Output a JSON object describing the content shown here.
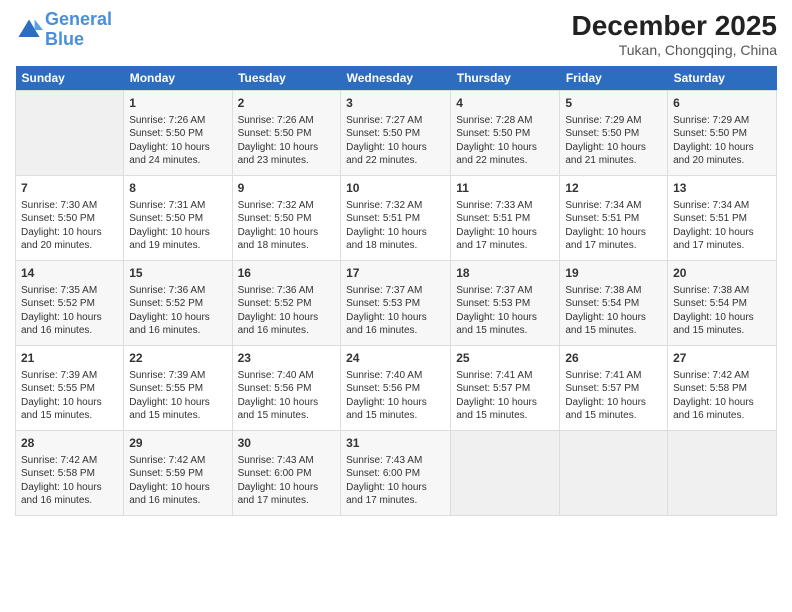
{
  "header": {
    "logo_line1": "General",
    "logo_line2": "Blue",
    "month": "December 2025",
    "location": "Tukan, Chongqing, China"
  },
  "weekdays": [
    "Sunday",
    "Monday",
    "Tuesday",
    "Wednesday",
    "Thursday",
    "Friday",
    "Saturday"
  ],
  "weeks": [
    [
      {
        "day": "",
        "info": ""
      },
      {
        "day": "1",
        "info": "Sunrise: 7:26 AM\nSunset: 5:50 PM\nDaylight: 10 hours\nand 24 minutes."
      },
      {
        "day": "2",
        "info": "Sunrise: 7:26 AM\nSunset: 5:50 PM\nDaylight: 10 hours\nand 23 minutes."
      },
      {
        "day": "3",
        "info": "Sunrise: 7:27 AM\nSunset: 5:50 PM\nDaylight: 10 hours\nand 22 minutes."
      },
      {
        "day": "4",
        "info": "Sunrise: 7:28 AM\nSunset: 5:50 PM\nDaylight: 10 hours\nand 22 minutes."
      },
      {
        "day": "5",
        "info": "Sunrise: 7:29 AM\nSunset: 5:50 PM\nDaylight: 10 hours\nand 21 minutes."
      },
      {
        "day": "6",
        "info": "Sunrise: 7:29 AM\nSunset: 5:50 PM\nDaylight: 10 hours\nand 20 minutes."
      }
    ],
    [
      {
        "day": "7",
        "info": "Sunrise: 7:30 AM\nSunset: 5:50 PM\nDaylight: 10 hours\nand 20 minutes."
      },
      {
        "day": "8",
        "info": "Sunrise: 7:31 AM\nSunset: 5:50 PM\nDaylight: 10 hours\nand 19 minutes."
      },
      {
        "day": "9",
        "info": "Sunrise: 7:32 AM\nSunset: 5:50 PM\nDaylight: 10 hours\nand 18 minutes."
      },
      {
        "day": "10",
        "info": "Sunrise: 7:32 AM\nSunset: 5:51 PM\nDaylight: 10 hours\nand 18 minutes."
      },
      {
        "day": "11",
        "info": "Sunrise: 7:33 AM\nSunset: 5:51 PM\nDaylight: 10 hours\nand 17 minutes."
      },
      {
        "day": "12",
        "info": "Sunrise: 7:34 AM\nSunset: 5:51 PM\nDaylight: 10 hours\nand 17 minutes."
      },
      {
        "day": "13",
        "info": "Sunrise: 7:34 AM\nSunset: 5:51 PM\nDaylight: 10 hours\nand 17 minutes."
      }
    ],
    [
      {
        "day": "14",
        "info": "Sunrise: 7:35 AM\nSunset: 5:52 PM\nDaylight: 10 hours\nand 16 minutes."
      },
      {
        "day": "15",
        "info": "Sunrise: 7:36 AM\nSunset: 5:52 PM\nDaylight: 10 hours\nand 16 minutes."
      },
      {
        "day": "16",
        "info": "Sunrise: 7:36 AM\nSunset: 5:52 PM\nDaylight: 10 hours\nand 16 minutes."
      },
      {
        "day": "17",
        "info": "Sunrise: 7:37 AM\nSunset: 5:53 PM\nDaylight: 10 hours\nand 16 minutes."
      },
      {
        "day": "18",
        "info": "Sunrise: 7:37 AM\nSunset: 5:53 PM\nDaylight: 10 hours\nand 15 minutes."
      },
      {
        "day": "19",
        "info": "Sunrise: 7:38 AM\nSunset: 5:54 PM\nDaylight: 10 hours\nand 15 minutes."
      },
      {
        "day": "20",
        "info": "Sunrise: 7:38 AM\nSunset: 5:54 PM\nDaylight: 10 hours\nand 15 minutes."
      }
    ],
    [
      {
        "day": "21",
        "info": "Sunrise: 7:39 AM\nSunset: 5:55 PM\nDaylight: 10 hours\nand 15 minutes."
      },
      {
        "day": "22",
        "info": "Sunrise: 7:39 AM\nSunset: 5:55 PM\nDaylight: 10 hours\nand 15 minutes."
      },
      {
        "day": "23",
        "info": "Sunrise: 7:40 AM\nSunset: 5:56 PM\nDaylight: 10 hours\nand 15 minutes."
      },
      {
        "day": "24",
        "info": "Sunrise: 7:40 AM\nSunset: 5:56 PM\nDaylight: 10 hours\nand 15 minutes."
      },
      {
        "day": "25",
        "info": "Sunrise: 7:41 AM\nSunset: 5:57 PM\nDaylight: 10 hours\nand 15 minutes."
      },
      {
        "day": "26",
        "info": "Sunrise: 7:41 AM\nSunset: 5:57 PM\nDaylight: 10 hours\nand 15 minutes."
      },
      {
        "day": "27",
        "info": "Sunrise: 7:42 AM\nSunset: 5:58 PM\nDaylight: 10 hours\nand 16 minutes."
      }
    ],
    [
      {
        "day": "28",
        "info": "Sunrise: 7:42 AM\nSunset: 5:58 PM\nDaylight: 10 hours\nand 16 minutes."
      },
      {
        "day": "29",
        "info": "Sunrise: 7:42 AM\nSunset: 5:59 PM\nDaylight: 10 hours\nand 16 minutes."
      },
      {
        "day": "30",
        "info": "Sunrise: 7:43 AM\nSunset: 6:00 PM\nDaylight: 10 hours\nand 17 minutes."
      },
      {
        "day": "31",
        "info": "Sunrise: 7:43 AM\nSunset: 6:00 PM\nDaylight: 10 hours\nand 17 minutes."
      },
      {
        "day": "",
        "info": ""
      },
      {
        "day": "",
        "info": ""
      },
      {
        "day": "",
        "info": ""
      }
    ]
  ]
}
